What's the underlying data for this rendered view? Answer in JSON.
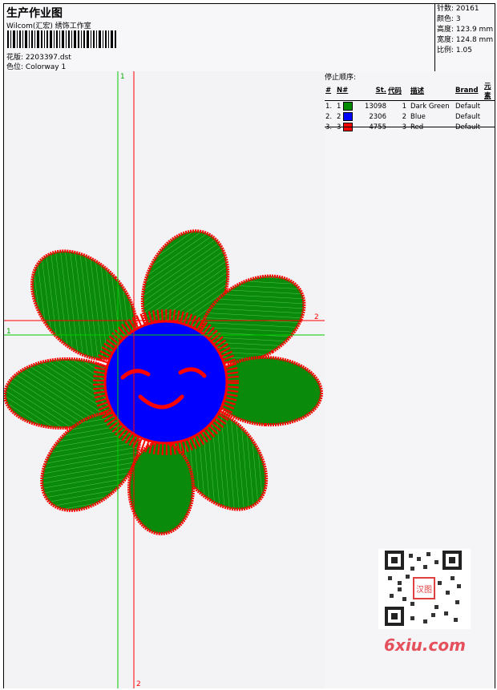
{
  "header": {
    "title": "生产作业图",
    "studio": "Wilcom(汇宏) 绣饰工作室",
    "design_label": "花版:",
    "design_file": "2203397.dst",
    "colorway_label": "色位:",
    "colorway": "Colorway 1"
  },
  "stats": {
    "stitches_label": "针数:",
    "stitches": "20161",
    "colors_label": "颜色:",
    "colors": "3",
    "height_label": "高度:",
    "height": "123.9 mm",
    "width_label": "宽度:",
    "width": "124.8 mm",
    "scale_label": "比例:",
    "scale": "1.05"
  },
  "stop_sequence": {
    "heading": "停止顺序:",
    "columns": [
      "#",
      "N#",
      "St.",
      "代码",
      "描述",
      "Brand",
      "元素"
    ],
    "rows": [
      {
        "num": "1.",
        "n": "1",
        "color": "#008a00",
        "st": "13098",
        "code": "1",
        "desc": "Dark Green",
        "brand": "Default"
      },
      {
        "num": "2.",
        "n": "2",
        "color": "#0000ff",
        "st": "2306",
        "code": "2",
        "desc": "Blue",
        "brand": "Default"
      },
      {
        "num": "3.",
        "n": "3",
        "color": "#ff0000",
        "st": "4755",
        "code": "3",
        "desc": "Red",
        "brand": "Default"
      }
    ]
  },
  "guides": {
    "green_top": "1",
    "green_left": "1",
    "red_right": "2",
    "red_bottom": "2"
  },
  "watermark": {
    "text": "6xiu.com",
    "seal": "汉图"
  },
  "colors": {
    "green": "#008a00",
    "blue": "#0000ff",
    "red": "#ff0000",
    "guide_green": "#00cc00",
    "guide_red": "#ff0000"
  }
}
